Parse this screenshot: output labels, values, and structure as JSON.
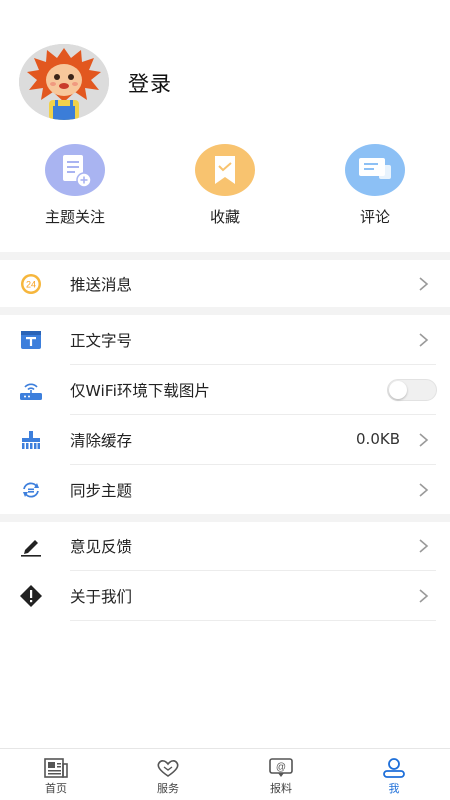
{
  "profile": {
    "login_label": "登录"
  },
  "quick_actions": [
    {
      "label": "主题关注",
      "icon": "topic-add-icon",
      "color": "#a9b4f1"
    },
    {
      "label": "收藏",
      "icon": "favorite-icon",
      "color": "#f8c36f"
    },
    {
      "label": "评论",
      "icon": "comment-icon",
      "color": "#8cc0f5"
    }
  ],
  "settings": {
    "push": {
      "label": "推送消息",
      "badge": "24"
    },
    "font_size": {
      "label": "正文字号"
    },
    "wifi_only": {
      "label": "仅WiFi环境下载图片",
      "enabled": false
    },
    "clear_cache": {
      "label": "清除缓存",
      "value": "0.0KB"
    },
    "sync_topics": {
      "label": "同步主题"
    },
    "feedback": {
      "label": "意见反馈"
    },
    "about": {
      "label": "关于我们"
    }
  },
  "tabbar": [
    {
      "label": "首页",
      "icon": "newspaper-icon",
      "active": false
    },
    {
      "label": "服务",
      "icon": "heart-hands-icon",
      "active": false
    },
    {
      "label": "报料",
      "icon": "report-chat-icon",
      "active": false
    },
    {
      "label": "我",
      "icon": "user-icon",
      "active": true
    }
  ],
  "colors": {
    "accent": "#1e6fd9",
    "icon_blue": "#3d7fdc",
    "divider": "#ececec",
    "section_gap": "#f3f3f3"
  }
}
